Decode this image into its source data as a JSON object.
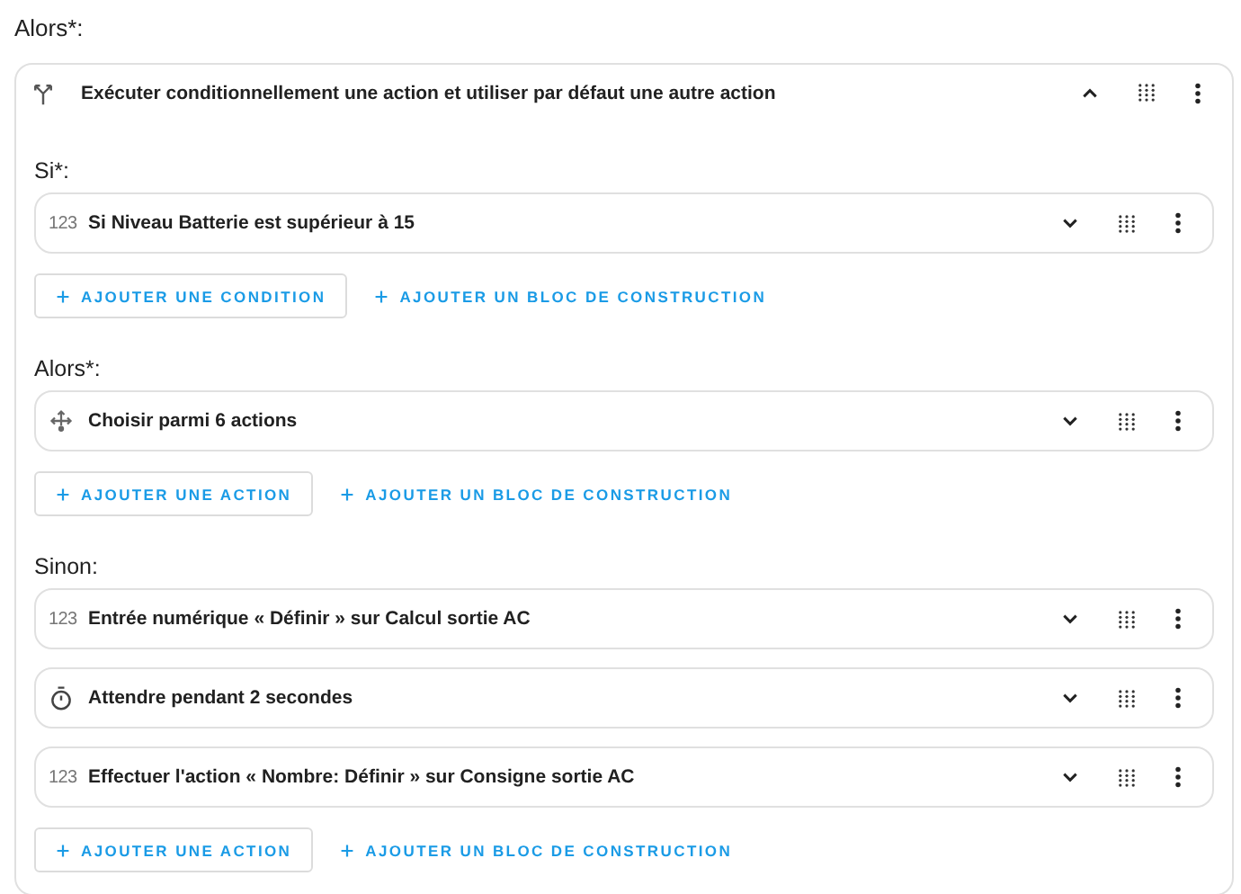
{
  "heading": "Alors*:",
  "block": {
    "kind": "branch",
    "title": "Exécuter conditionnellement une action et utiliser par défaut une autre action",
    "expanded": true,
    "sections": [
      {
        "label": "Si*:",
        "items": [
          {
            "kind": "number",
            "icon_text": "123",
            "text": "Si Niveau Batterie est supérieur à 15",
            "expanded": false
          }
        ],
        "buttons": [
          {
            "kind": "outlined",
            "label": "AJOUTER UNE CONDITION"
          },
          {
            "kind": "text",
            "label": "AJOUTER UN BLOC DE CONSTRUCTION"
          }
        ]
      },
      {
        "label": "Alors*:",
        "items": [
          {
            "kind": "choose",
            "text": "Choisir parmi 6 actions",
            "expanded": false
          }
        ],
        "buttons": [
          {
            "kind": "outlined",
            "label": "AJOUTER UNE ACTION"
          },
          {
            "kind": "text",
            "label": "AJOUTER UN BLOC DE CONSTRUCTION"
          }
        ]
      },
      {
        "label": "Sinon:",
        "items": [
          {
            "kind": "number",
            "icon_text": "123",
            "text": "Entrée numérique « Définir » sur Calcul sortie AC",
            "expanded": false
          },
          {
            "kind": "delay",
            "text": "Attendre pendant 2 secondes",
            "expanded": false
          },
          {
            "kind": "number",
            "icon_text": "123",
            "text": "Effectuer l'action « Nombre: Définir » sur Consigne sortie AC",
            "expanded": false
          }
        ],
        "buttons": [
          {
            "kind": "outlined",
            "label": "AJOUTER UNE ACTION"
          },
          {
            "kind": "text",
            "label": "AJOUTER UN BLOC DE CONSTRUCTION"
          }
        ]
      }
    ]
  }
}
